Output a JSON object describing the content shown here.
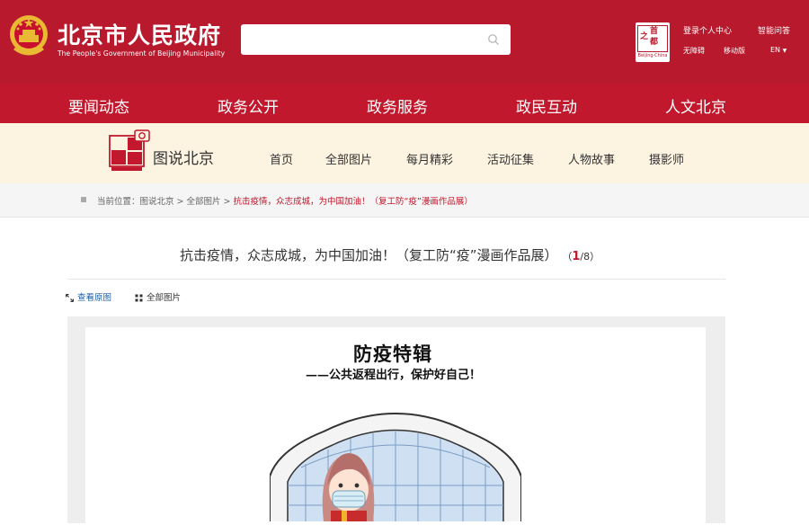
{
  "header": {
    "site_title": "北京市人民政府",
    "site_subtitle": "The People's Government of Beijing Municipality",
    "search_placeholder": "",
    "capital_logo_chars": [
      "之",
      "首",
      "都"
    ],
    "capital_logo_en": "Beijing·China",
    "links": {
      "login": "登录个人中心",
      "smart_qa": "智能问答",
      "accessibility": "无障碍",
      "mobile": "移动版",
      "language": "EN"
    }
  },
  "main_nav": [
    "要闻动态",
    "政务公开",
    "政务服务",
    "政民互动",
    "人文北京"
  ],
  "section": {
    "title": "图说北京",
    "nav": [
      "首页",
      "全部图片",
      "每月精彩",
      "活动征集",
      "人物故事",
      "摄影师"
    ]
  },
  "breadcrumb": {
    "prefix": "当前位置：图说北京 > 全部图片 > ",
    "current": "抗击疫情，众志成城，为中国加油！（复工防“疫”漫画作品展）"
  },
  "article": {
    "title": "抗击疫情，众志成城，为中国加油！（复工防“疫”漫画作品展）",
    "page_current": "1",
    "page_total": "/8）",
    "page_open": "（",
    "view_original": "查看原图",
    "all_images": "全部图片"
  },
  "comic": {
    "title": "防疫特辑",
    "subtitle": "——公共返程出行，保护好自己！"
  },
  "colors": {
    "header_red": "#b8192c",
    "nav_red": "#c1182d",
    "section_bg": "#fcf3e1",
    "link_blue": "#1d5ea8"
  }
}
